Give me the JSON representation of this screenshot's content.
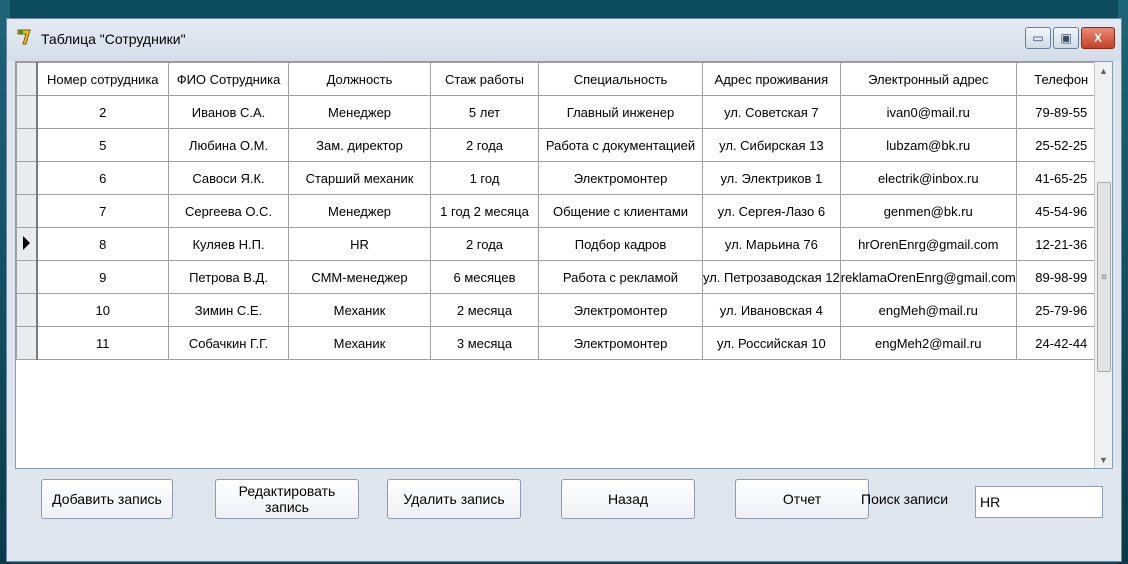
{
  "window": {
    "title": "Таблица \"Сотрудники\"",
    "minimize_glyph": "▭",
    "maximize_glyph": "▣",
    "close_glyph": "X"
  },
  "table": {
    "columns": [
      "Номер сотрудника",
      "ФИО Сотрудника",
      "Должность",
      "Стаж работы",
      "Специальность",
      "Адрес проживания",
      "Электронный адрес",
      "Телефон"
    ],
    "rows": [
      [
        "2",
        "Иванов С.А.",
        "Менеджер",
        "5 лет",
        "Главный инженер",
        "ул. Советская 7",
        "ivan0@mail.ru",
        "79-89-55"
      ],
      [
        "5",
        "Любина О.М.",
        "Зам. директор",
        "2 года",
        "Работа с документацией",
        "ул. Сибирская 13",
        "lubzam@bk.ru",
        "25-52-25"
      ],
      [
        "6",
        "Савоси Я.К.",
        "Старший механик",
        "1 год",
        "Электромонтер",
        "ул. Электриков 1",
        "electrik@inbox.ru",
        "41-65-25"
      ],
      [
        "7",
        "Сергеева О.С.",
        "Менеджер",
        "1 год 2 месяца",
        "Общение с клиентами",
        "ул. Сергея-Лазо 6",
        "genmen@bk.ru",
        "45-54-96"
      ],
      [
        "8",
        "Куляев Н.П.",
        "HR",
        "2 года",
        "Подбор кадров",
        "ул. Марьина 76",
        "hrOrenEnrg@gmail.com",
        "12-21-36"
      ],
      [
        "9",
        "Петрова В.Д.",
        "СММ-менеджер",
        "6 месяцев",
        "Работа с рекламой",
        "ул. Петрозаводская 12",
        "reklamaOrenEnrg@gmail.com",
        "89-98-99"
      ],
      [
        "10",
        "Зимин С.Е.",
        "Механик",
        "2 месяца",
        "Электромонтер",
        "ул. Ивановская 4",
        "engMeh@mail.ru",
        "25-79-96"
      ],
      [
        "11",
        "Собачкин Г.Г.",
        "Механик",
        "3 месяца",
        "Электромонтер",
        "ул. Российская 10",
        "engMeh2@mail.ru",
        "24-42-44"
      ]
    ],
    "current_row_index": 4
  },
  "scrollbar": {
    "up": "▲",
    "down": "▼",
    "grip": "≡"
  },
  "buttons": {
    "add": "Добавить запись",
    "edit": "Редактировать запись",
    "delete": "Удалить запись",
    "back": "Назад",
    "report": "Отчет"
  },
  "search": {
    "label": "Поиск записи",
    "value": "HR"
  },
  "colors": {
    "desktop": "#0c4a5e",
    "window": "#dfe6ee",
    "close_button": "#c4412a"
  },
  "icons": {
    "app": "app-logo-icon",
    "row_pointer": "current-row-pointer-icon"
  }
}
